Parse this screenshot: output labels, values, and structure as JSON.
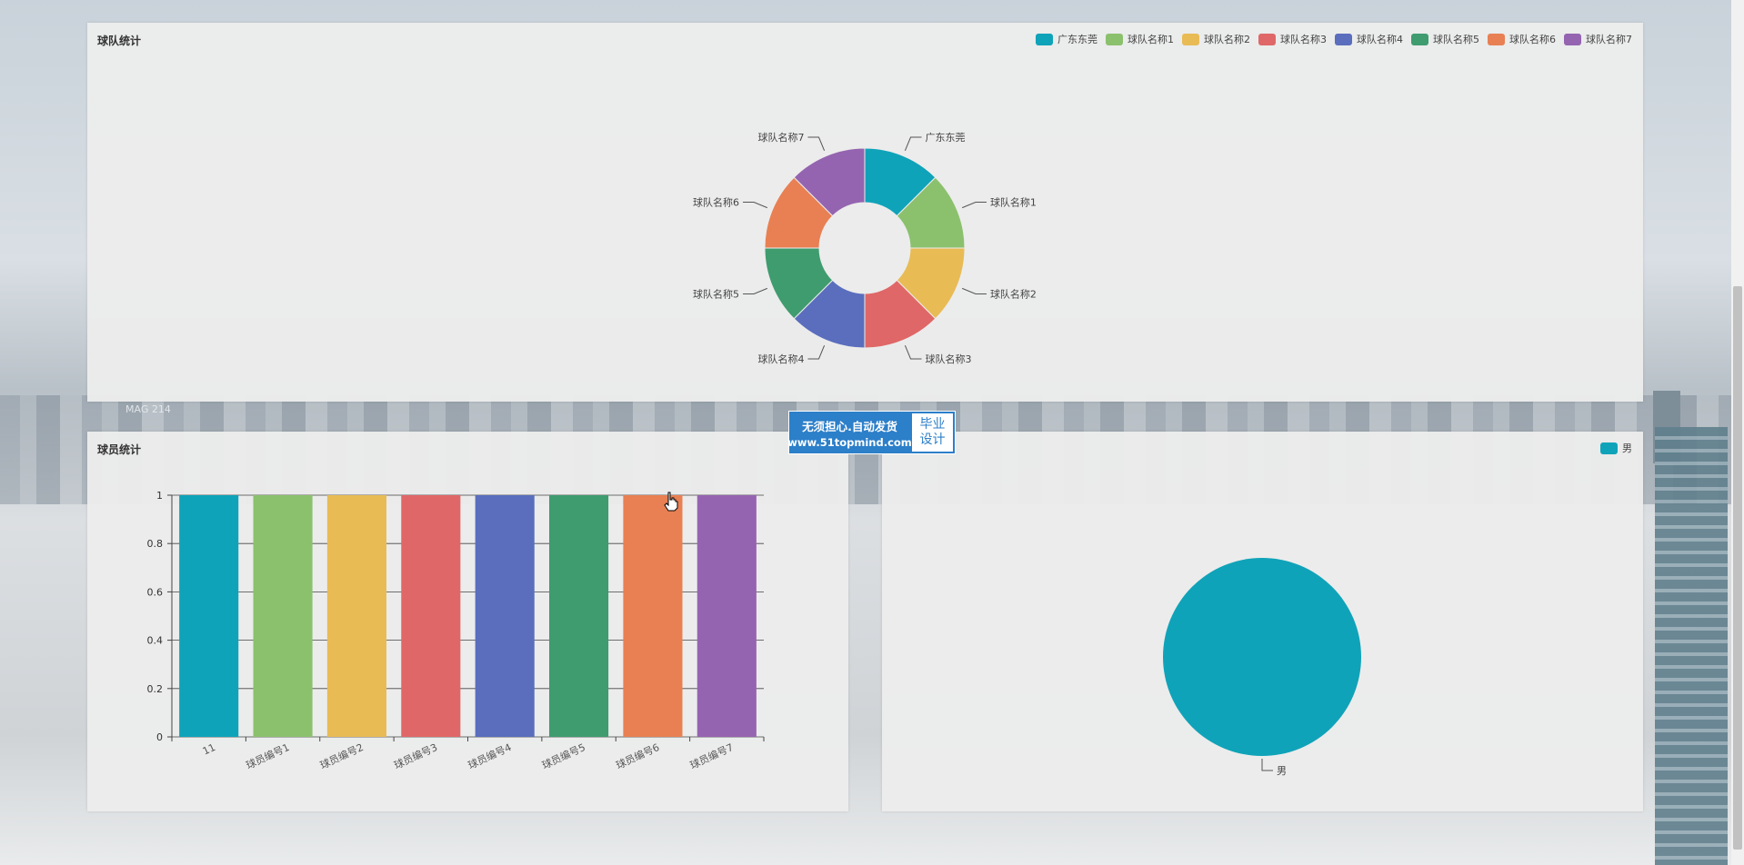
{
  "team_panel": {
    "title": "球队统计",
    "legend": [
      "广东东莞",
      "球队名称1",
      "球队名称2",
      "球队名称3",
      "球队名称4",
      "球队名称5",
      "球队名称6",
      "球队名称7"
    ]
  },
  "player_panel": {
    "title": "球员统计"
  },
  "gender_panel": {
    "legend": [
      "男"
    ]
  },
  "watermark": {
    "line1": "无须担心.自动发货",
    "line2": "www.51topmind.com",
    "badge1": "毕业",
    "badge2": "设计"
  },
  "colors": [
    "#0fa3b9",
    "#8bc16d",
    "#e8bb55",
    "#e06767",
    "#5a6ebd",
    "#3f9c6f",
    "#e88053",
    "#9564b0"
  ],
  "chart_data": [
    {
      "type": "pie",
      "variant": "donut",
      "title": "球队统计",
      "categories": [
        "广东东莞",
        "球队名称1",
        "球队名称2",
        "球队名称3",
        "球队名称4",
        "球队名称5",
        "球队名称6",
        "球队名称7"
      ],
      "values": [
        1,
        1,
        1,
        1,
        1,
        1,
        1,
        1
      ],
      "legend_position": "top-right"
    },
    {
      "type": "bar",
      "title": "球员统计",
      "categories": [
        "11",
        "球员编号1",
        "球员编号2",
        "球员编号3",
        "球员编号4",
        "球员编号5",
        "球员编号6",
        "球员编号7"
      ],
      "values": [
        1,
        1,
        1,
        1,
        1,
        1,
        1,
        1
      ],
      "ylim": [
        0,
        1
      ],
      "yticks": [
        "0",
        "0.2",
        "0.4",
        "0.6",
        "0.8",
        "1"
      ],
      "grid": true
    },
    {
      "type": "pie",
      "categories": [
        "男"
      ],
      "values": [
        1
      ],
      "legend_position": "top-right"
    }
  ]
}
